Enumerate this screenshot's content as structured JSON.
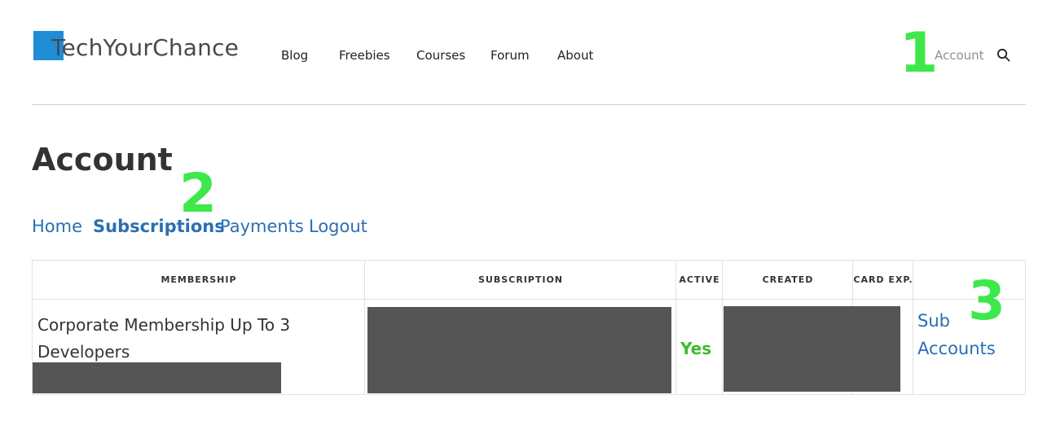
{
  "header": {
    "logo_text": "TechYourChance",
    "nav": [
      "Blog",
      "Freebies",
      "Courses",
      "Forum",
      "About"
    ],
    "account_label": "Account",
    "search_icon": "search-icon"
  },
  "annotations": [
    "1",
    "2",
    "3"
  ],
  "page": {
    "title": "Account",
    "subnav": {
      "home": "Home",
      "subscriptions": "Subscriptions",
      "payments": "Payments",
      "logout": "Logout"
    }
  },
  "table": {
    "headers": [
      "MEMBERSHIP",
      "SUBSCRIPTION",
      "ACTIVE",
      "CREATED",
      "CARD EXP."
    ],
    "row": {
      "membership": "Corporate Membership Up To 3 Developers",
      "active": "Yes",
      "sub_accounts": "Sub Accounts"
    }
  },
  "colors": {
    "brand_blue": "#1f8dd6",
    "link_blue": "#2a6fb3",
    "annotation_green": "#3ee84a",
    "active_green": "#3dbb2e",
    "redaction": "#555555"
  }
}
